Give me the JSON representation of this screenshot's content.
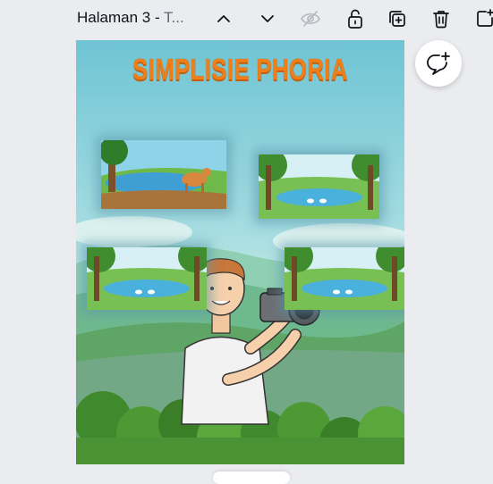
{
  "toolbar": {
    "page_title": "Halaman 3",
    "separator": " - ",
    "page_subtitle": "T...",
    "icons": [
      "chevron-up-icon",
      "chevron-down-icon",
      "hide-icon",
      "lock-icon",
      "duplicate-icon",
      "trash-icon",
      "add-page-icon"
    ]
  },
  "design": {
    "title": "SIMPLISIE PHORIA",
    "title_color": "#ef7f1a",
    "sky_color": "#7ccbd6",
    "grass_color": "#5fa566"
  },
  "comment_button": {
    "icon": "add-comment-icon"
  }
}
